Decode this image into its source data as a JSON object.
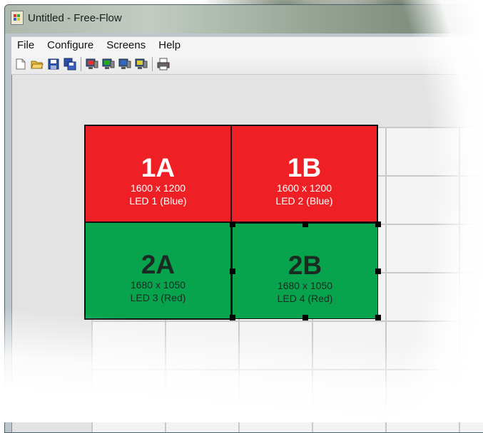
{
  "window": {
    "title": "Untitled - Free-Flow"
  },
  "menu": {
    "file": "File",
    "configure": "Configure",
    "screens": "Screens",
    "help": "Help"
  },
  "toolbar": {
    "icons": [
      "new-icon",
      "open-icon",
      "save-icon",
      "save-all-icon",
      "monitor-red-icon",
      "monitor-green-icon",
      "monitor-blue-icon",
      "monitor-yellow-icon",
      "print-icon"
    ]
  },
  "screens": [
    {
      "id": "1A",
      "res": "1600 x 1200",
      "led": "LED 1 (Blue)",
      "color": "#ee2025"
    },
    {
      "id": "1B",
      "res": "1600 x 1200",
      "led": "LED 2 (Blue)",
      "color": "#ee2025"
    },
    {
      "id": "2A",
      "res": "1680 x 1050",
      "led": "LED 3 (Red)",
      "color": "#07a34d"
    },
    {
      "id": "2B",
      "res": "1680 x 1050",
      "led": "LED 4 (Red)",
      "color": "#07a34d",
      "selected": true
    }
  ]
}
